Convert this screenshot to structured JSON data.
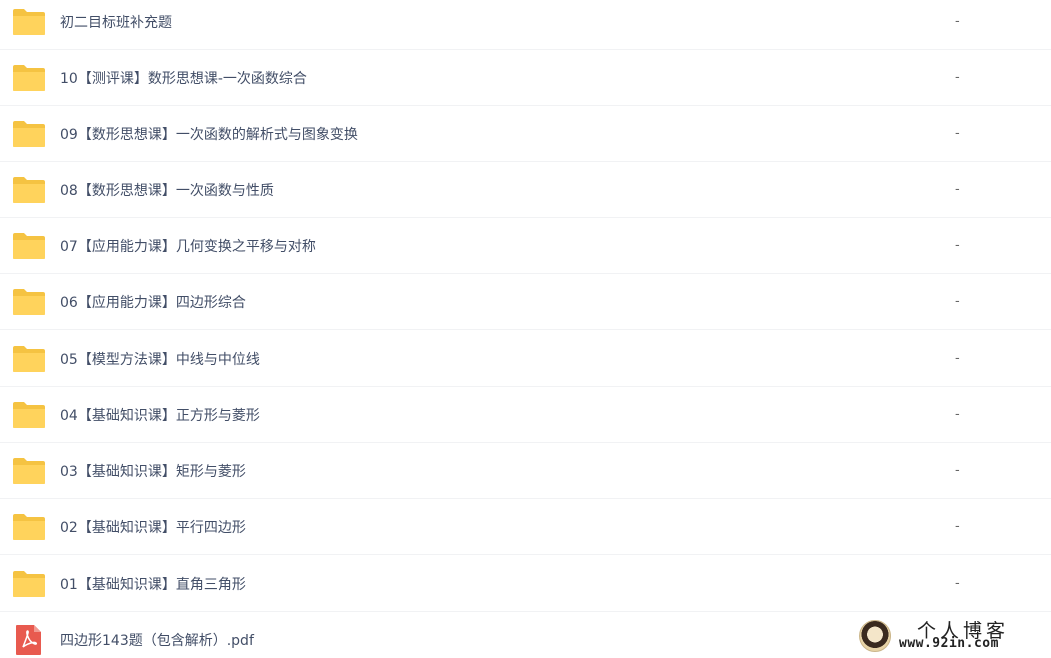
{
  "files": [
    {
      "name": "初二目标班补充题",
      "size": "-",
      "type": "folder"
    },
    {
      "name": "10【测评课】数形思想课-一次函数综合",
      "size": "-",
      "type": "folder"
    },
    {
      "name": "09【数形思想课】一次函数的解析式与图象变换",
      "size": "-",
      "type": "folder"
    },
    {
      "name": "08【数形思想课】一次函数与性质",
      "size": "-",
      "type": "folder"
    },
    {
      "name": "07【应用能力课】几何变换之平移与对称",
      "size": "-",
      "type": "folder"
    },
    {
      "name": "06【应用能力课】四边形综合",
      "size": "-",
      "type": "folder"
    },
    {
      "name": "05【模型方法课】中线与中位线",
      "size": "-",
      "type": "folder"
    },
    {
      "name": "04【基础知识课】正方形与菱形",
      "size": "-",
      "type": "folder"
    },
    {
      "name": "03【基础知识课】矩形与菱形",
      "size": "-",
      "type": "folder"
    },
    {
      "name": "02【基础知识课】平行四边形",
      "size": "-",
      "type": "folder"
    },
    {
      "name": "01【基础知识课】直角三角形",
      "size": "-",
      "type": "folder"
    },
    {
      "name": "四边形143题（包含解析）.pdf",
      "size": "",
      "type": "pdf"
    }
  ],
  "watermark": {
    "title": "个人博客",
    "url": "www.92in.com"
  },
  "colors": {
    "folder": "#ffd35c",
    "folder_dark": "#f5c342",
    "pdf": "#e85a4f",
    "text": "#424e67"
  },
  "icons": {
    "folder": "folder-icon",
    "pdf": "pdf-file-icon"
  }
}
